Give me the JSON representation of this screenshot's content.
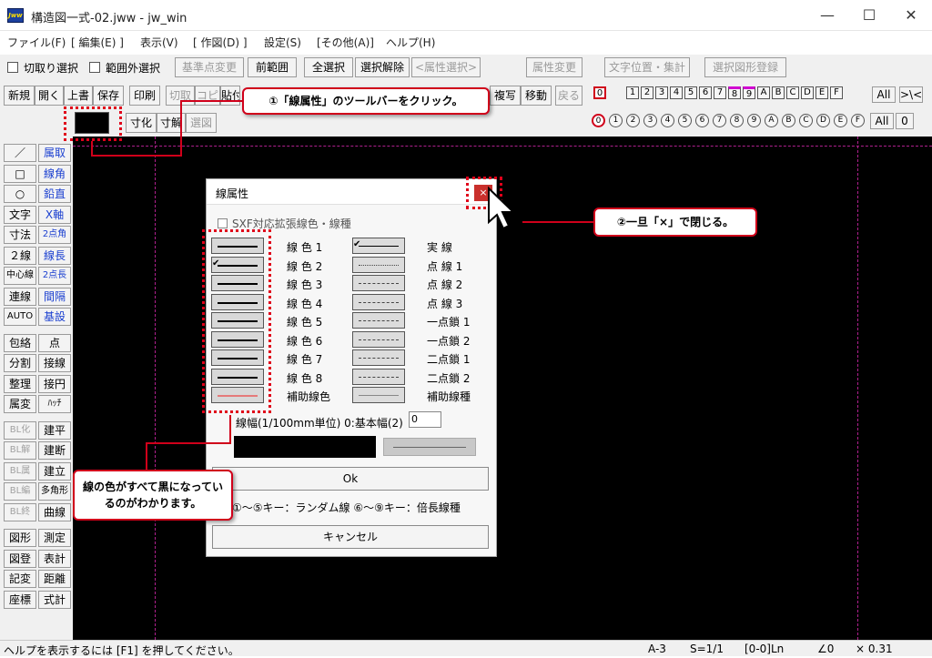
{
  "window": {
    "title": "構造図一式-02.jww - jw_win",
    "app_icon_text": "Jww",
    "minimize": "—",
    "maximize": "☐",
    "close": "✕"
  },
  "menu": [
    "ファイル(F)",
    "[ 編集(E) ]",
    "表示(V)",
    "[ 作図(D) ]",
    "設定(S)",
    "[その他(A)]",
    "ヘルプ(H)"
  ],
  "toolbar1": {
    "clip_select": "切取り選択",
    "outside_select": "範囲外選択",
    "base_change": "基準点変更",
    "prev_range": "前範囲",
    "select_all": "全選択",
    "deselect": "選択解除",
    "attr_select": "<属性選択>",
    "attr_change": "属性変更",
    "text_pos": "文字位置・集計",
    "register": "選択図形登録"
  },
  "toolbar2": {
    "new": "新規",
    "open": "開く",
    "overwrite": "上書",
    "save": "保存",
    "print": "印刷",
    "cut": "切取",
    "copy": "コピ",
    "paste": "貼付",
    "dup": "複写",
    "move": "移動",
    "back": "戻る",
    "layers": [
      "0",
      "1",
      "2",
      "3",
      "4",
      "5",
      "6",
      "7",
      "8",
      "9",
      "A",
      "B",
      "C",
      "D",
      "E",
      "F"
    ],
    "all": "All",
    "arrow": ">\\<"
  },
  "toolbar3": {
    "dim": "寸化",
    "dimsolve": "寸解",
    "selfig": "選図",
    "groups": [
      "0",
      "1",
      "2",
      "3",
      "4",
      "5",
      "6",
      "7",
      "8",
      "9",
      "A",
      "B",
      "C",
      "D",
      "E",
      "F"
    ],
    "all": "All",
    "zero": "0"
  },
  "left_tools": [
    [
      "／",
      "属取"
    ],
    [
      "□",
      "線角"
    ],
    [
      "○",
      "鉛直"
    ],
    [
      "文字",
      "X軸"
    ],
    [
      "寸法",
      "2点角"
    ],
    [
      "２線",
      "線長"
    ],
    [
      "中心線",
      "2点長"
    ],
    [
      "連線",
      "間隔"
    ],
    [
      "AUTO",
      "基設"
    ],
    [
      "包絡",
      "点"
    ],
    [
      "分割",
      "接線"
    ],
    [
      "整理",
      "接円"
    ],
    [
      "属変",
      "ﾊｯﾁ"
    ],
    [
      "BL化",
      "建平"
    ],
    [
      "BL解",
      "建断"
    ],
    [
      "BL属",
      "建立"
    ],
    [
      "BL編",
      "多角形"
    ],
    [
      "BL終",
      "曲線"
    ],
    [
      "図形",
      "測定"
    ],
    [
      "図登",
      "表計"
    ],
    [
      "記変",
      "距離"
    ],
    [
      "座標",
      "式計"
    ]
  ],
  "status": {
    "help": "ヘルプを表示するには [F1] を押してください。",
    "paper": "A-3",
    "scale": "S=1/1",
    "layer": "[0-0]Ln",
    "angle": "∠0",
    "zoom": "× 0.31"
  },
  "dialog": {
    "title": "線属性",
    "close": "×",
    "sxf": "SXF対応拡張線色・線種",
    "colors": [
      "線 色 1",
      "線 色 2",
      "線 色 3",
      "線 色 4",
      "線 色 5",
      "線 色 6",
      "線 色 7",
      "線 色 8",
      "補助線色"
    ],
    "types": [
      "実 線",
      "点 線 1",
      "点 線 2",
      "点 線 3",
      "一点鎖 1",
      "一点鎖 2",
      "二点鎖 1",
      "二点鎖 2",
      "補助線種"
    ],
    "width_label": "線幅(1/100mm単位) 0:基本幅(2)",
    "width_value": "0",
    "ok": "Ok",
    "hint": "①〜⑤キー：ランダム線 ⑥〜⑨キー：倍長線種",
    "cancel": "キャンセル"
  },
  "callouts": {
    "c1": "①「線属性」のツールバーをクリック。",
    "c2": "②一旦「×」で閉じる。",
    "c3": "線の色がすべて黒になっているのがわかります。"
  },
  "colors": {
    "accent_red": "#d0001a",
    "canvas": "#000000",
    "guide": "#b0208e"
  }
}
